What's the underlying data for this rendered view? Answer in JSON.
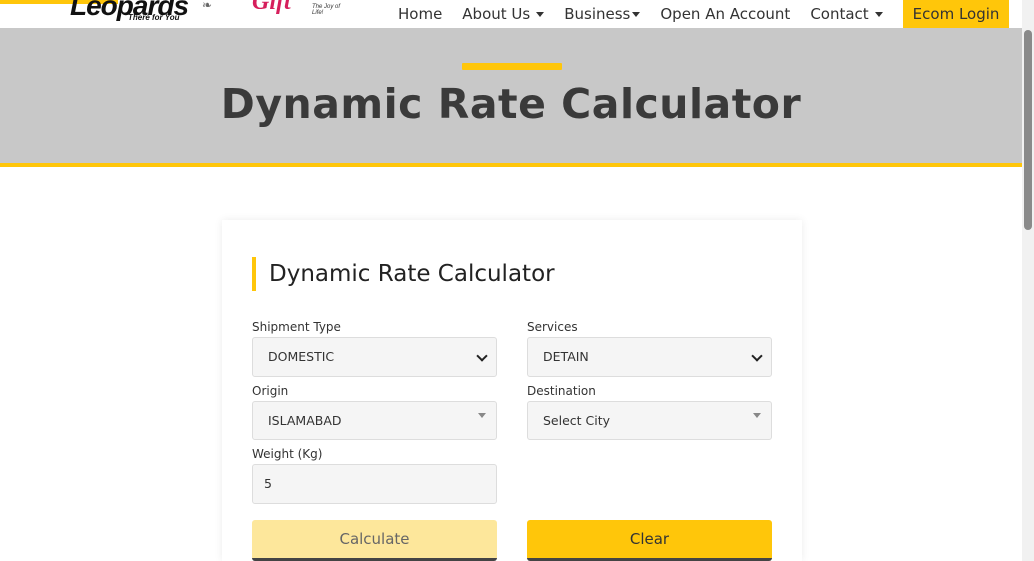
{
  "header": {
    "logo_text": "Leopards",
    "logo_tagline": "There for You",
    "partner_logo_text": "Gift",
    "partner_tagline": "The Joy of Life!",
    "nav": [
      {
        "label": "Home",
        "has_caret": false
      },
      {
        "label": "About Us",
        "has_caret": true
      },
      {
        "label": "Business",
        "has_caret": true
      },
      {
        "label": "Open An Account",
        "has_caret": false
      },
      {
        "label": "Contact",
        "has_caret": true
      }
    ],
    "login_label": "Ecom Login"
  },
  "hero": {
    "title": "Dynamic Rate Calculator"
  },
  "calculator": {
    "title": "Dynamic Rate Calculator",
    "shipment_type": {
      "label": "Shipment Type",
      "value": "DOMESTIC"
    },
    "services": {
      "label": "Services",
      "value": "DETAIN"
    },
    "origin": {
      "label": "Origin",
      "value": "ISLAMABAD"
    },
    "destination": {
      "label": "Destination",
      "value": "Select City"
    },
    "weight": {
      "label": "Weight (Kg)",
      "value": "5"
    },
    "calculate_label": "Calculate",
    "clear_label": "Clear"
  },
  "colors": {
    "accent": "#ffc60a",
    "hero_bg": "#c8c8c8",
    "calculate_bg": "#fde79b"
  }
}
